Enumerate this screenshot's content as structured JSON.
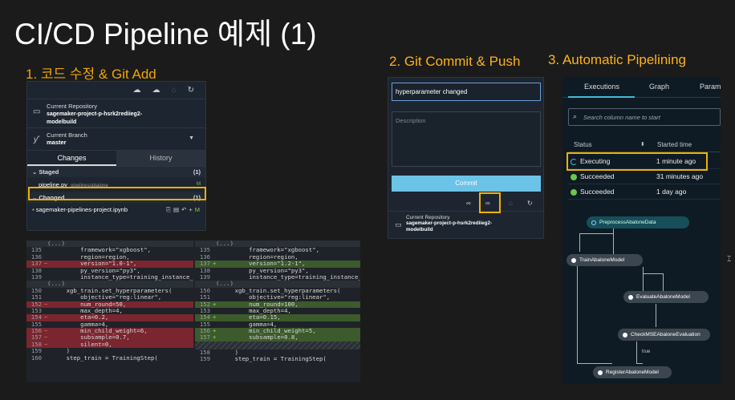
{
  "slide": {
    "title": "CI/CD Pipeline 예제 (1)"
  },
  "steps": {
    "s1": "1. 코드 수정 & Git Add",
    "s2": "2. Git Commit & Push",
    "s3": "3. Automatic Pipelining"
  },
  "git_panel": {
    "repo_label": "Current Repository",
    "repo_value_1": "sagemaker-project-p-hsrk2rediieg2-",
    "repo_value_2": "modelbuild",
    "branch_label": "Current Branch",
    "branch_value": "master",
    "tabs": [
      "Changes",
      "History"
    ],
    "staged_label": "Staged",
    "staged_count": "(1)",
    "staged_file": "pipeline.py",
    "staged_path": "pipelines/abalone",
    "staged_status": "M",
    "changed_label": "Changed",
    "changed_count": "(1)",
    "changed_file": "sagemaker-pipelines-project.ipynb",
    "changed_status": "M"
  },
  "diff": {
    "fold": "(...)",
    "left": [
      {
        "n": "135",
        "t": "        framework=\"xgboost\","
      },
      {
        "n": "136",
        "t": "        region=region,"
      },
      {
        "n": "137",
        "t": "        version=\"1.0-1\",",
        "k": "del"
      },
      {
        "n": "138",
        "t": "        py_version=\"py3\","
      },
      {
        "n": "139",
        "t": "        instance_type=training_instance_type,"
      },
      {
        "n": "150",
        "t": "    xgb_train.set_hyperparameters("
      },
      {
        "n": "151",
        "t": "        objective=\"reg:linear\","
      },
      {
        "n": "152",
        "t": "        num_round=50,",
        "k": "del"
      },
      {
        "n": "153",
        "t": "        max_depth=4,"
      },
      {
        "n": "154",
        "t": "        eta=0.2,",
        "k": "del"
      },
      {
        "n": "155",
        "t": "        gamma=4,"
      },
      {
        "n": "156",
        "t": "        min_child_weight=6,",
        "k": "del"
      },
      {
        "n": "157",
        "t": "        subsample=0.7,",
        "k": "del"
      },
      {
        "n": "158",
        "t": "        silent=0,",
        "k": "del"
      },
      {
        "n": "159",
        "t": "    )"
      },
      {
        "n": "160",
        "t": "    step_train = TrainingStep("
      }
    ],
    "right": [
      {
        "n": "135",
        "t": "        framework=\"xgboost\","
      },
      {
        "n": "136",
        "t": "        region=region,"
      },
      {
        "n": "137",
        "t": "        version=\"1.2-1\",",
        "k": "add"
      },
      {
        "n": "138",
        "t": "        py_version=\"py3\","
      },
      {
        "n": "139",
        "t": "        instance_type=training_instance_type,"
      },
      {
        "n": "150",
        "t": "    xgb_train.set_hyperparameters("
      },
      {
        "n": "151",
        "t": "        objective=\"reg:linear\","
      },
      {
        "n": "152",
        "t": "        num_round=100,",
        "k": "add"
      },
      {
        "n": "153",
        "t": "        max_depth=4,"
      },
      {
        "n": "154",
        "t": "        eta=0.15,",
        "k": "add"
      },
      {
        "n": "155",
        "t": "        gamma=4,"
      },
      {
        "n": "156",
        "t": "        min_child_weight=5,",
        "k": "add"
      },
      {
        "n": "157",
        "t": "        subsample=0.8,",
        "k": "add"
      },
      {
        "n": "158",
        "t": "    )"
      },
      {
        "n": "159",
        "t": "    step_train = TrainingStep("
      }
    ]
  },
  "commit_panel": {
    "summary": "hyperparameter changed",
    "description_placeholder": "Description",
    "commit_label": "Commit",
    "repo_label": "Current Repository",
    "repo_value_1": "sagemaker-project-p-hsrk2rediieg2-",
    "repo_value_2": "modelbuild"
  },
  "pipeline_panel": {
    "tabs": [
      "Executions",
      "Graph",
      "Param"
    ],
    "search_placeholder": "Search column name to start",
    "col_status": "Status",
    "col_started": "Started time",
    "rows": [
      {
        "status": "Executing",
        "time": "1 minute ago"
      },
      {
        "status": "Succeeded",
        "time": "31 minutes ago"
      },
      {
        "status": "Succeeded",
        "time": "1 day ago"
      }
    ],
    "nodes": {
      "n1": "PreprocessAbaloneData",
      "n2": "TrainAbaloneModel",
      "n3": "EvaluateAbaloneModel",
      "n4": "CheckMSEAbaloneEvaluation",
      "n5": "RegisterAbaloneModel"
    },
    "edge_label": "true"
  },
  "colors": {
    "highlight": "#f0b000",
    "step_title": "#f0a500",
    "success": "#69c84a",
    "accent": "#44b9d6"
  }
}
